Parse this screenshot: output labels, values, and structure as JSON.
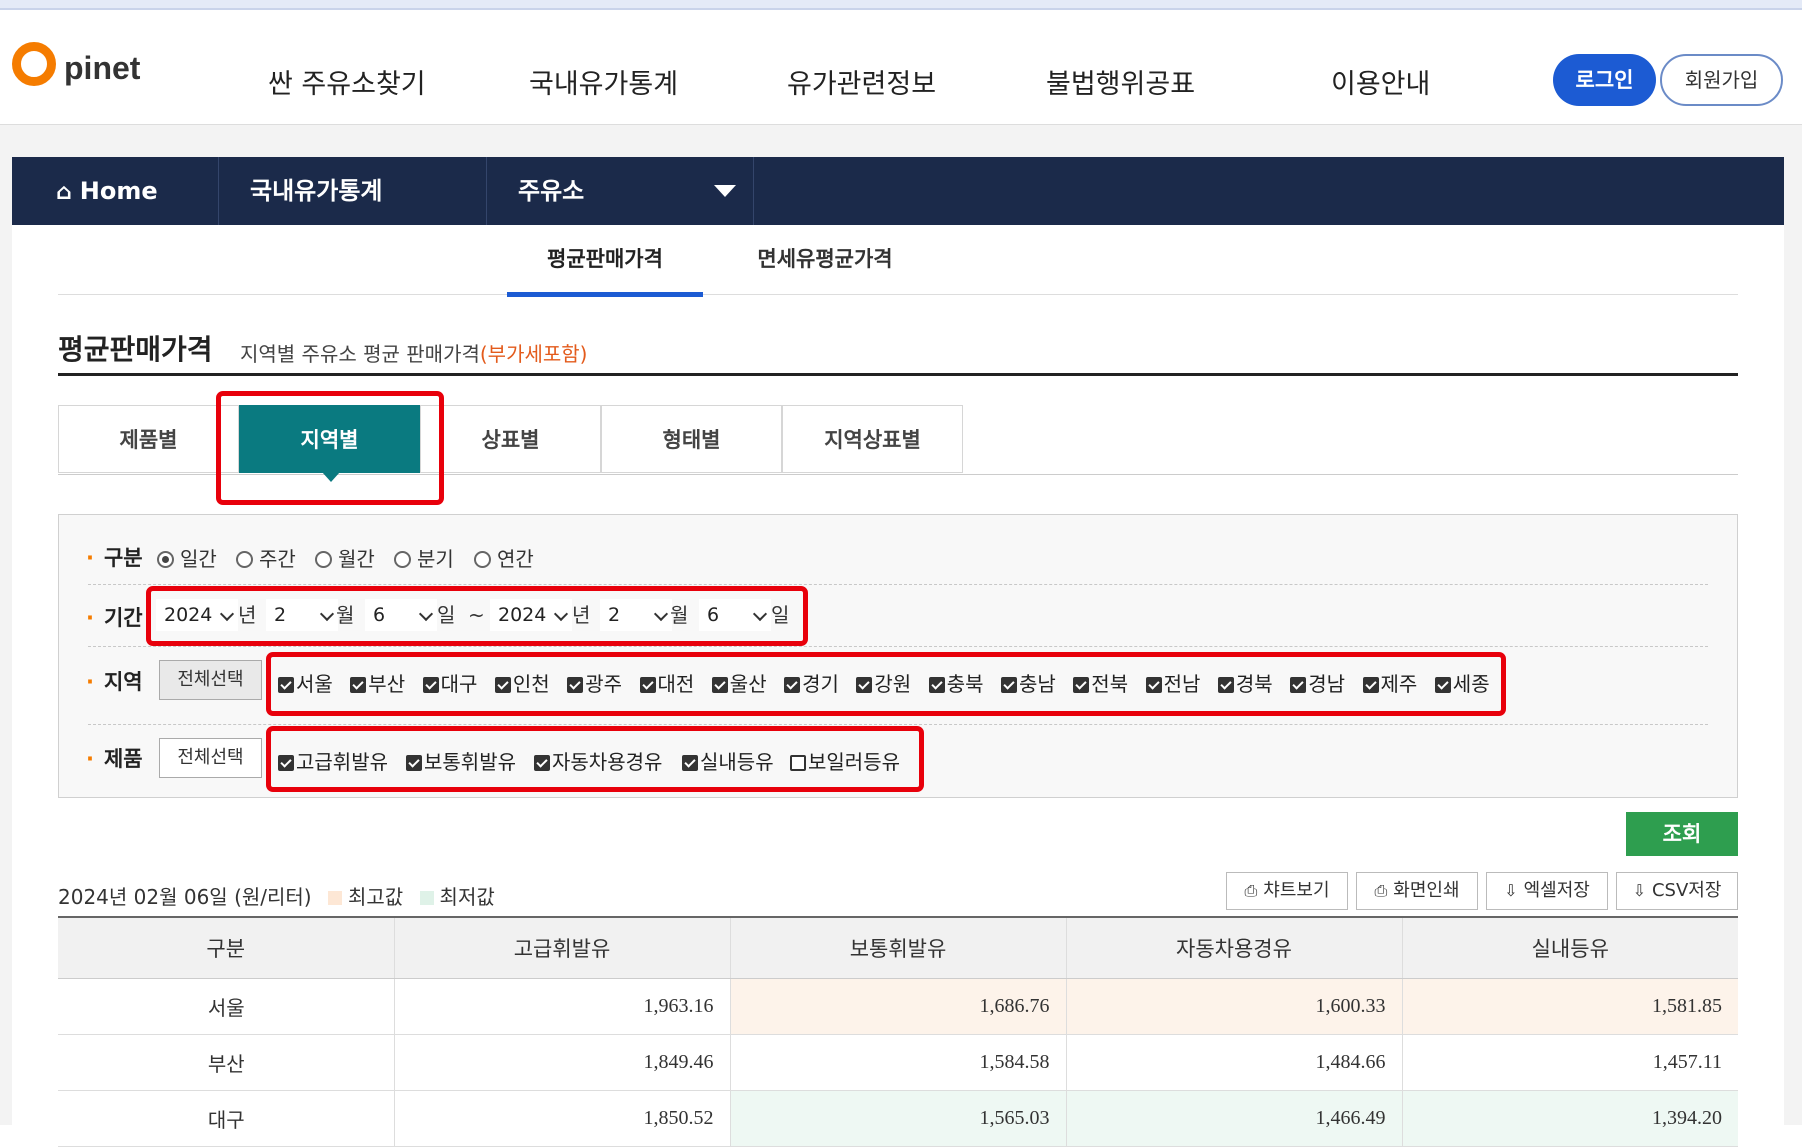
{
  "logo": {
    "letter": "O",
    "text": "pinet"
  },
  "gnb": [
    "싼 주유소찾기",
    "국내유가통계",
    "유가관련정보",
    "불법행위공표",
    "이용안내"
  ],
  "auth": {
    "login": "로그인",
    "join": "회원가입"
  },
  "location_nav": {
    "home": "Home",
    "level1": "국내유가통계",
    "level2": "주유소"
  },
  "sub_tabs": [
    "평균판매가격",
    "면세유평균가격"
  ],
  "page": {
    "title": "평균판매가격",
    "subtitle": "지역별 주유소 평균 판매가격",
    "subtitle_vat": "(부가세포함)"
  },
  "category_tabs": [
    "제품별",
    "지역별",
    "상표별",
    "형태별",
    "지역상표별"
  ],
  "filter": {
    "period_type": {
      "label": "구분",
      "options": [
        "일간",
        "주간",
        "월간",
        "분기",
        "연간"
      ],
      "selected": "일간"
    },
    "period": {
      "label": "기간",
      "from": {
        "year": "2024",
        "month": "2",
        "day": "6"
      },
      "to": {
        "year": "2024",
        "month": "2",
        "day": "6"
      },
      "units": {
        "year": "년",
        "month": "월",
        "day": "일",
        "tilde": "~"
      }
    },
    "region": {
      "label": "지역",
      "select_all": "전체선택",
      "items": [
        {
          "name": "서울",
          "checked": true
        },
        {
          "name": "부산",
          "checked": true
        },
        {
          "name": "대구",
          "checked": true
        },
        {
          "name": "인천",
          "checked": true
        },
        {
          "name": "광주",
          "checked": true
        },
        {
          "name": "대전",
          "checked": true
        },
        {
          "name": "울산",
          "checked": true
        },
        {
          "name": "경기",
          "checked": true
        },
        {
          "name": "강원",
          "checked": true
        },
        {
          "name": "충북",
          "checked": true
        },
        {
          "name": "충남",
          "checked": true
        },
        {
          "name": "전북",
          "checked": true
        },
        {
          "name": "전남",
          "checked": true
        },
        {
          "name": "경북",
          "checked": true
        },
        {
          "name": "경남",
          "checked": true
        },
        {
          "name": "제주",
          "checked": true
        },
        {
          "name": "세종",
          "checked": true
        }
      ]
    },
    "product": {
      "label": "제품",
      "select_all": "전체선택",
      "items": [
        {
          "name": "고급휘발유",
          "checked": true
        },
        {
          "name": "보통휘발유",
          "checked": true
        },
        {
          "name": "자동차용경유",
          "checked": true
        },
        {
          "name": "실내등유",
          "checked": true
        },
        {
          "name": "보일러등유",
          "checked": false
        }
      ]
    }
  },
  "search_button": "조회",
  "result": {
    "date_text": "2024년 02월 06일 (원/리터)",
    "legend_high": "최고값",
    "legend_low": "최저값",
    "colors": {
      "high": "#fdf3ea",
      "low": "#eef8f3"
    }
  },
  "tools": [
    "챠트보기",
    "화면인쇄",
    "엑셀저장",
    "CSV저장"
  ],
  "table": {
    "headers": [
      "구분",
      "고급휘발유",
      "보통휘발유",
      "자동차용경유",
      "실내등유"
    ],
    "rows": [
      [
        "서울",
        "1,963.16",
        "1,686.76",
        "1,600.33",
        "1,581.85"
      ],
      [
        "부산",
        "1,849.46",
        "1,584.58",
        "1,484.66",
        "1,457.11"
      ],
      [
        "대구",
        "1,850.52",
        "1,565.03",
        "1,466.49",
        "1,394.20"
      ]
    ],
    "highlight": [
      [
        "",
        "",
        "hi",
        "hi",
        "hi"
      ],
      [
        "",
        "",
        "",
        "",
        ""
      ],
      [
        "",
        "",
        "lo",
        "lo",
        "lo"
      ]
    ]
  }
}
